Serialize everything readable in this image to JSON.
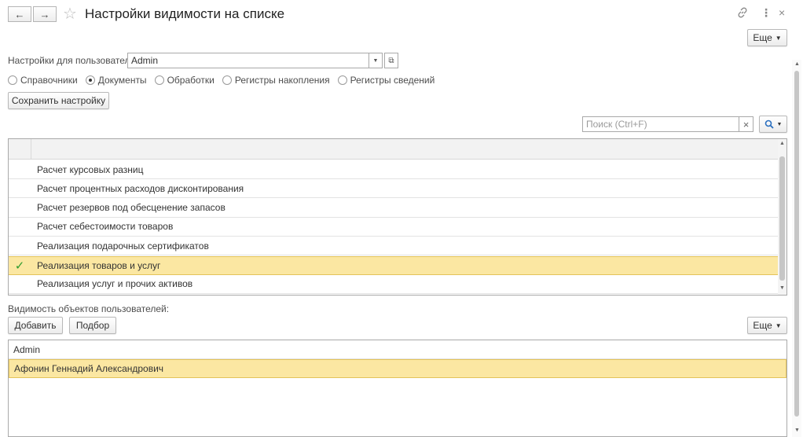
{
  "window": {
    "title": "Настройки видимости на списке",
    "more_label": "Еще"
  },
  "user_settings": {
    "label": "Настройки для пользователя:",
    "value": "Admin"
  },
  "object_types": [
    {
      "label": "Справочники",
      "selected": false
    },
    {
      "label": "Документы",
      "selected": true
    },
    {
      "label": "Обработки",
      "selected": false
    },
    {
      "label": "Регистры накопления",
      "selected": false
    },
    {
      "label": "Регистры сведений",
      "selected": false
    }
  ],
  "save_button": "Сохранить настройку",
  "search": {
    "placeholder": "Поиск (Ctrl+F)"
  },
  "documents": [
    {
      "name": "Расчет курсовых разниц",
      "checked": false
    },
    {
      "name": "Расчет процентных расходов дисконтирования",
      "checked": false
    },
    {
      "name": "Расчет резервов под обесценение запасов",
      "checked": false
    },
    {
      "name": "Расчет себестоимости товаров",
      "checked": false
    },
    {
      "name": "Реализация подарочных сертификатов",
      "checked": false
    },
    {
      "name": "Реализация товаров и услуг",
      "checked": true
    },
    {
      "name": "Реализация услуг и прочих активов",
      "checked": false
    }
  ],
  "visibility": {
    "label": "Видимость объектов пользователей:",
    "add_button": "Добавить",
    "pick_button": "Подбор",
    "more_label": "Еще",
    "users": [
      {
        "name": "Admin",
        "selected": false
      },
      {
        "name": "Афонин Геннадий Александрович",
        "selected": true
      }
    ]
  },
  "colors": {
    "selection": "#fbe7a2",
    "check": "#2e9b2e"
  }
}
